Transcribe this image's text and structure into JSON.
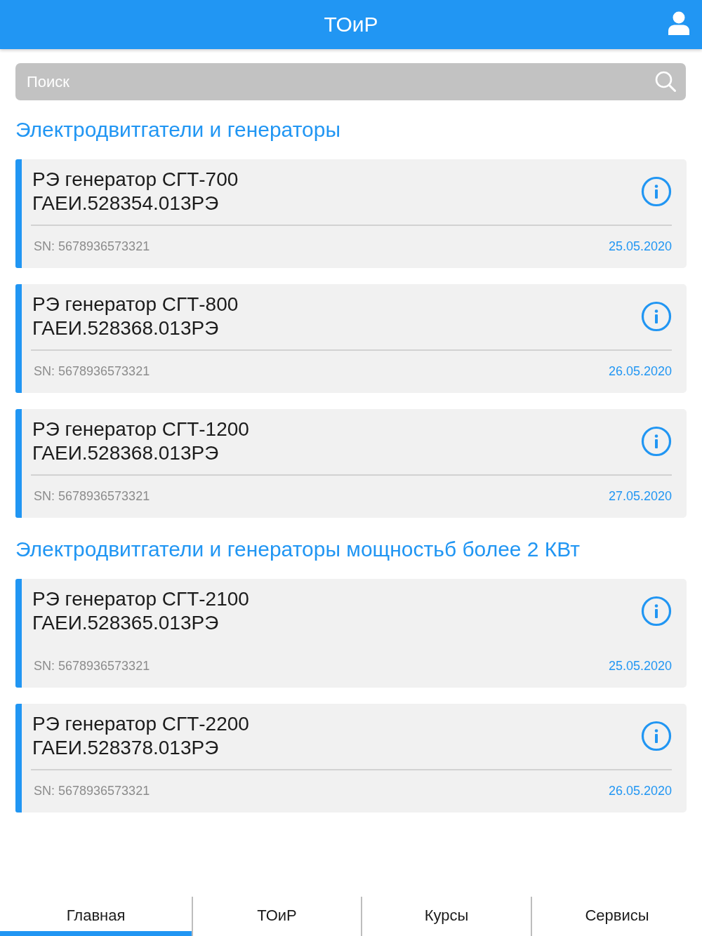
{
  "header": {
    "title": "ТОиР"
  },
  "search": {
    "placeholder": "Поиск"
  },
  "sections": [
    {
      "title": "Электродвитгатели и генераторы",
      "items": [
        {
          "title": "РЭ генератор СГТ-700",
          "code": "ГАЕИ.528354.013РЭ",
          "divider": true,
          "serial": "SN: 5678936573321",
          "date": "25.05.2020"
        },
        {
          "title": "РЭ генератор СГТ-800",
          "code": "ГАЕИ.528368.013РЭ",
          "divider": true,
          "serial": "SN: 5678936573321",
          "date": "26.05.2020"
        },
        {
          "title": "РЭ генератор СГТ-1200",
          "code": "ГАЕИ.528368.013РЭ",
          "divider": true,
          "serial": "SN: 5678936573321",
          "date": "27.05.2020"
        }
      ]
    },
    {
      "title": "Электродвитгатели и генераторы мощностьб более 2 КВт",
      "items": [
        {
          "title": "РЭ генератор СГТ-2100",
          "code": "ГАЕИ.528365.013РЭ",
          "divider": false,
          "serial": "SN: 5678936573321",
          "date": "25.05.2020"
        },
        {
          "title": "РЭ генератор СГТ-2200",
          "code": "ГАЕИ.528378.013РЭ",
          "divider": true,
          "serial": "SN: 5678936573321",
          "date": "26.05.2020"
        }
      ]
    }
  ],
  "tabs": [
    {
      "label": "Главная",
      "selected": true
    },
    {
      "label": "ТОиР",
      "selected": false
    },
    {
      "label": "Курсы",
      "selected": false
    },
    {
      "label": "Сервисы",
      "selected": false
    }
  ]
}
